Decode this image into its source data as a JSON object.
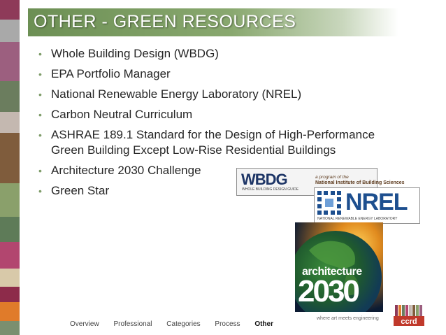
{
  "slide": {
    "title": "OTHER - GREEN RESOURCES",
    "bullets": [
      {
        "line1": "Whole Building Design (WBDG)",
        "line2": ""
      },
      {
        "line1": "EPA Portfolio Manager",
        "line2": ""
      },
      {
        "line1": "National Renewable Energy Laboratory (NREL)",
        "line2": ""
      },
      {
        "line1": "Carbon Neutral Curriculum",
        "line2": ""
      },
      {
        "line1": "ASHRAE 189.1 Standard for the Design of High-Performance",
        "line2": "Green Building Except Low-Rise Residential Buildings"
      },
      {
        "line1": "Architecture 2030 Challenge",
        "line2": ""
      },
      {
        "line1": "Green Star",
        "line2": ""
      }
    ],
    "bullet_glyph": "•"
  },
  "logos": {
    "wbdg": {
      "mark": "WBDG",
      "sub": "WHOLE BUILDING DESIGN GUIDE",
      "program": "a program of the",
      "institute": "National Institute of Building Sciences"
    },
    "nrel": {
      "mark": "NREL",
      "sub": "NATIONAL RENEWABLE ENERGY LABORATORY"
    },
    "arch2030": {
      "word": "architecture",
      "year": "2030"
    },
    "ccrd": {
      "text": "ccrd"
    }
  },
  "footer": {
    "nav": [
      "Overview",
      "Professional",
      "Categories",
      "Process",
      "Other"
    ],
    "active": "Other",
    "tagline": "where art meets engineering"
  },
  "colors": {
    "title_green": "#6c8f54",
    "strip": [
      "#8e3a59",
      "#a9a9a9",
      "#9c5f7f",
      "#6b7d5e",
      "#c4b8b0",
      "#7f5c3c",
      "#8aa06b",
      "#5e7b58",
      "#b2466f",
      "#d8c9a9",
      "#8d2b4a",
      "#e07b2a",
      "#7b8f6f"
    ]
  }
}
